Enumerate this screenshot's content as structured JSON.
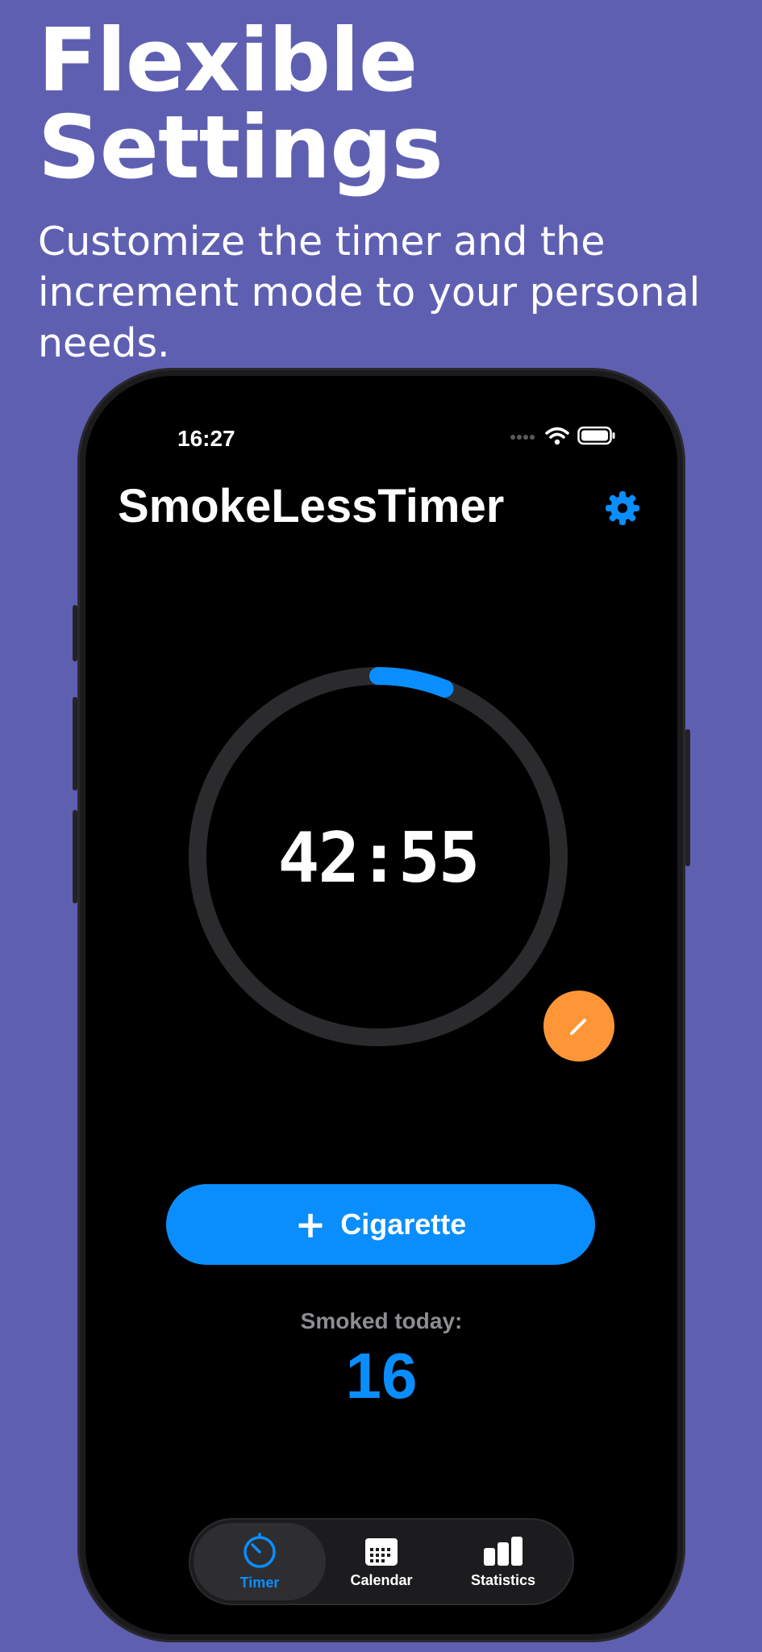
{
  "promo": {
    "headline": "Flexible\nSettings",
    "subheadline": "Customize the timer and the increment mode to your personal needs."
  },
  "status_bar": {
    "time": "16:27"
  },
  "app": {
    "title": "SmokeLessTimer",
    "timer_display": "42:55",
    "timer_progress": 0.06,
    "add_button_plus": "+",
    "add_button_label": "Cigarette",
    "smoked_label": "Smoked today:",
    "smoked_count": "16"
  },
  "tabs": [
    {
      "label": "Timer",
      "icon": "timer-icon",
      "active": true
    },
    {
      "label": "Calendar",
      "icon": "calendar-icon",
      "active": false
    },
    {
      "label": "Statistics",
      "icon": "statistics-icon",
      "active": false
    }
  ],
  "colors": {
    "background": "#5f5fb2",
    "accent": "#0a8efe",
    "edit": "#fe9637",
    "ring_track": "#2b2b2e"
  }
}
